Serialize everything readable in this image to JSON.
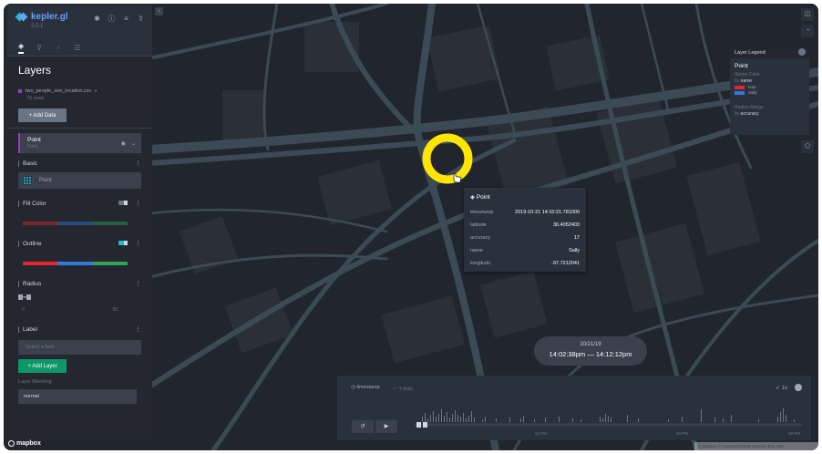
{
  "app": {
    "name": "kepler.gl",
    "version": "2.0.1"
  },
  "panel_tabs": [
    "layers-tab",
    "filters-tab",
    "interactions-tab",
    "map-style-tab"
  ],
  "layers_panel": {
    "title": "Layers",
    "dataset": {
      "name": "two_people_one_location.csv",
      "rows": "76 rows",
      "color": "#a335c9"
    },
    "add_data_label": "+  Add Data",
    "layer": {
      "name": "Point",
      "type": "Point"
    },
    "sections": {
      "basic": "Basic",
      "basic_type": "Point",
      "fill_color": "Fill Color",
      "outline": "Outline",
      "radius": "Radius",
      "radius_min": "0",
      "radius_max": "50",
      "label": "Label",
      "label_placeholder": "Select a field"
    },
    "add_layer_label": "+  Add Layer",
    "blending_label": "Layer Blending",
    "blending_value": "normal"
  },
  "legend": {
    "header": "Layer Legend",
    "layer": "Point",
    "stroke_label": "Stroke Color",
    "stroke_by_prefix": "by",
    "stroke_by_field": "name",
    "items": [
      {
        "label": "Ivan",
        "color": "#e3262f"
      },
      {
        "label": "Sally",
        "color": "#2f7bd6"
      }
    ],
    "radius_label": "Radius Range",
    "radius_by_prefix": "by",
    "radius_by_field": "accuracy"
  },
  "tooltip": {
    "title": "Point",
    "rows": [
      {
        "key": "timestamp",
        "value": "2019-10-21 14:10:21.781000"
      },
      {
        "key": "latitude",
        "value": "30.4052403"
      },
      {
        "key": "accuracy",
        "value": "17"
      },
      {
        "key": "name",
        "value": "Sally"
      },
      {
        "key": "longitude",
        "value": "-97.7212041"
      }
    ]
  },
  "time_window": {
    "date": "10/21/19",
    "start": "14:02:38pm",
    "sep": "—",
    "end": "14:12:12pm"
  },
  "time_filter": {
    "field": "timestamp",
    "y_axis": "Y Axis",
    "speed": "1x",
    "ticks": [
      "02 PM",
      "06 PM",
      "08 PM"
    ]
  },
  "mapbox": "mapbox",
  "attribution": "© Mapbox © OpenStreetMap Improve this map",
  "colors": {
    "accent": "#1fbad6",
    "highlight": "#ffe600",
    "add_layer": "#0f9668"
  }
}
